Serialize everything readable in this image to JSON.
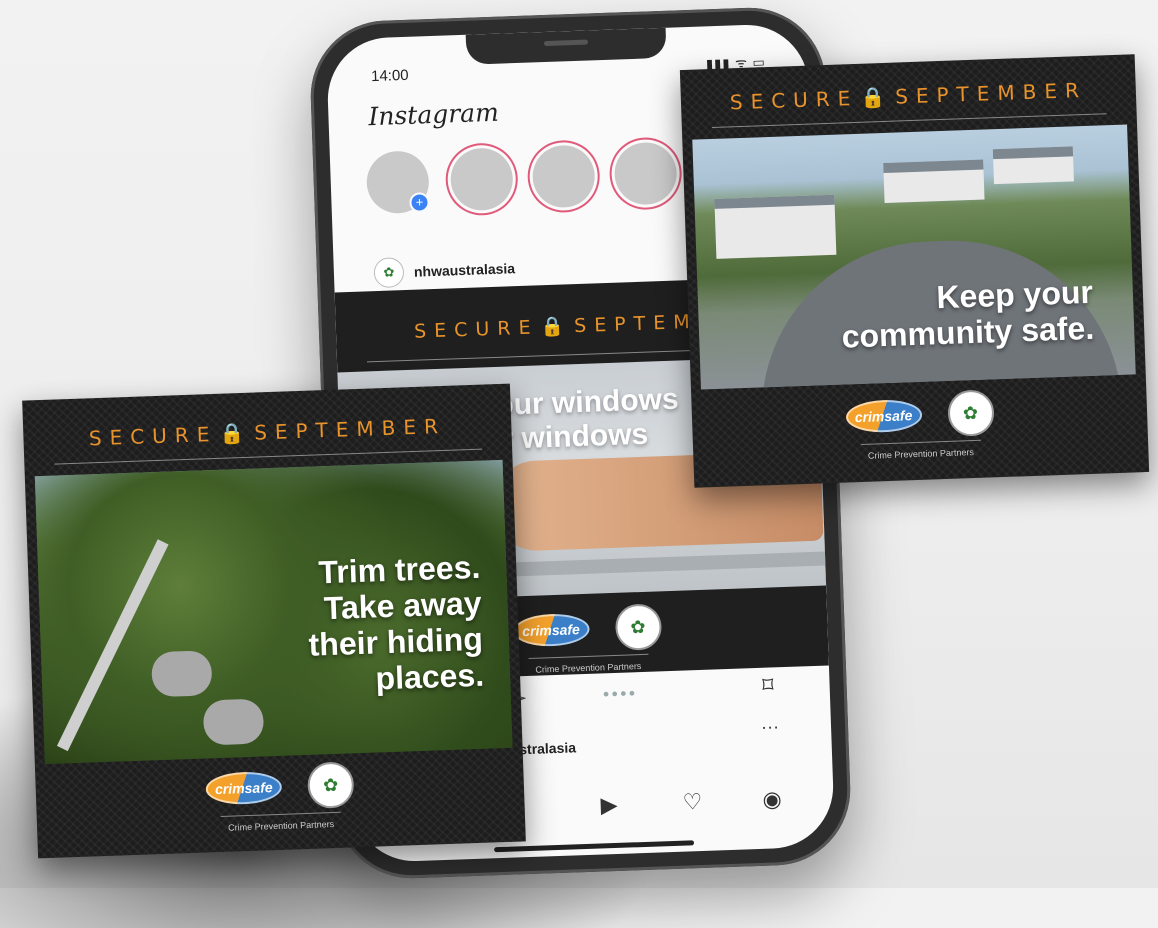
{
  "status_bar": {
    "time": "14:00",
    "icons": "▮▮▮ ᯤ ▭"
  },
  "app": {
    "name": "Instagram",
    "new_post_icon": "plus-square-icon"
  },
  "stories": [
    {
      "kind": "add",
      "badge": "+"
    },
    {
      "kind": "ring"
    },
    {
      "kind": "ring"
    },
    {
      "kind": "ring"
    }
  ],
  "post": {
    "username": "nhwaustralasia",
    "username_partial": "ustralasia",
    "avatar_glyph": "✿",
    "carousel_dots": "●●●●",
    "headline_line1": "Clean your windows",
    "headline_line2": "eck your windows",
    "more_glyph": "···"
  },
  "banner": {
    "left_word": "SECURE",
    "lock_glyph": "🔒",
    "right_word": "SEPTEMBER",
    "phone_right_partial": "SEPTEMBE"
  },
  "cards": {
    "right": {
      "line1": "Keep your",
      "line2": "community safe."
    },
    "left": {
      "line1": "Trim trees.",
      "line2": "Take away",
      "line3": "their hiding",
      "line4": "places."
    }
  },
  "partners": {
    "crimsafe_label": "crimsafe",
    "nhw_glyph": "✿",
    "caption": "Crime Prevention Partners"
  },
  "tabbar": {
    "search": "⌕",
    "reels": "▶",
    "heart": "♡",
    "profile": "◉"
  },
  "icons": {
    "share": "➢",
    "bookmark": "⌑"
  }
}
